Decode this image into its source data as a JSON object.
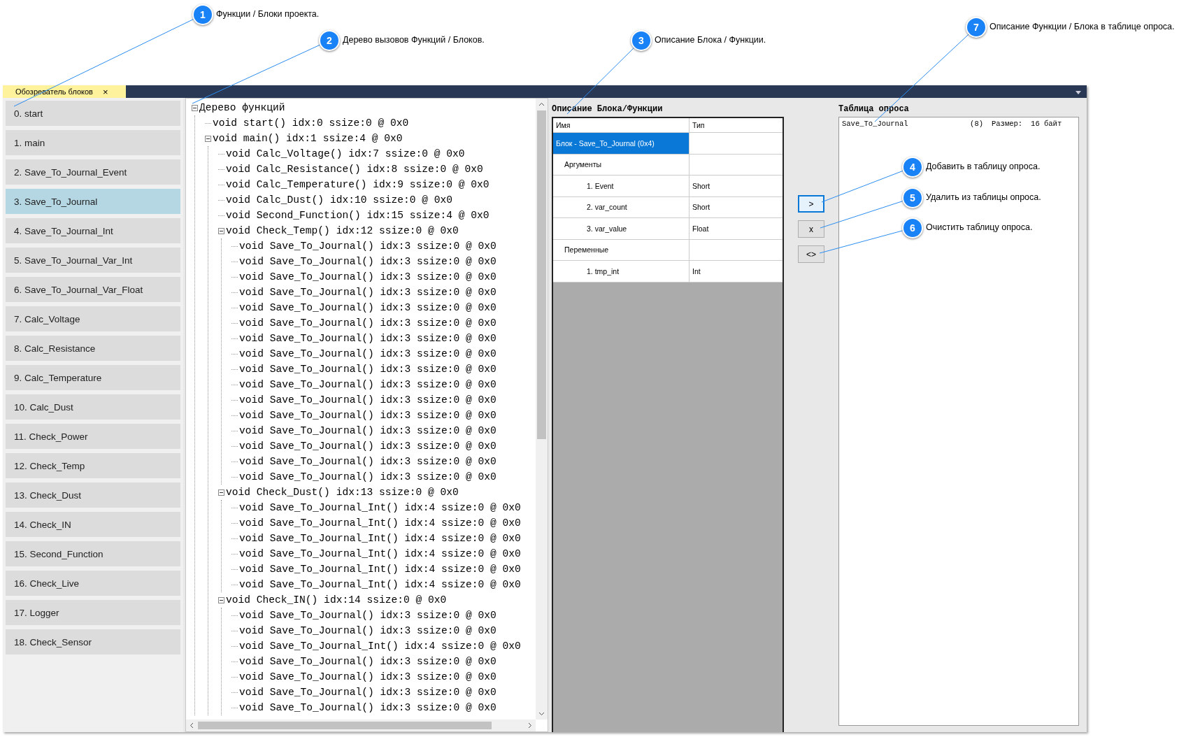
{
  "callouts": [
    {
      "number": "1",
      "text": "Функции / Блоки проекта."
    },
    {
      "number": "2",
      "text": "Дерево вызовов Функций / Блоков."
    },
    {
      "number": "3",
      "text": "Описание Блока / Функции."
    },
    {
      "number": "7",
      "text": "Описание Функции / Блока в таблице опроса."
    },
    {
      "number": "4",
      "text": "Добавить в таблицу опроса."
    },
    {
      "number": "5",
      "text": "Удалить из таблицы опроса."
    },
    {
      "number": "6",
      "text": "Очистить таблицу опроса."
    }
  ],
  "tab": {
    "label": "Обозреватель блоков",
    "close": "×",
    "selected": true
  },
  "blocks": [
    {
      "label": "0. start",
      "selected": false
    },
    {
      "label": "1. main",
      "selected": false
    },
    {
      "label": "2. Save_To_Journal_Event",
      "selected": false
    },
    {
      "label": "3. Save_To_Journal",
      "selected": true
    },
    {
      "label": "4. Save_To_Journal_Int",
      "selected": false
    },
    {
      "label": "5. Save_To_Journal_Var_Int",
      "selected": false
    },
    {
      "label": "6. Save_To_Journal_Var_Float",
      "selected": false
    },
    {
      "label": "7. Calc_Voltage",
      "selected": false
    },
    {
      "label": "8. Calc_Resistance",
      "selected": false
    },
    {
      "label": "9. Calc_Temperature",
      "selected": false
    },
    {
      "label": "10. Calc_Dust",
      "selected": false
    },
    {
      "label": "11. Check_Power",
      "selected": false
    },
    {
      "label": "12. Check_Temp",
      "selected": false
    },
    {
      "label": "13. Check_Dust",
      "selected": false
    },
    {
      "label": "14. Check_IN",
      "selected": false
    },
    {
      "label": "15. Second_Function",
      "selected": false
    },
    {
      "label": "16. Check_Live",
      "selected": false
    },
    {
      "label": "17. Logger",
      "selected": false
    },
    {
      "label": "18. Check_Sensor",
      "selected": false
    }
  ],
  "tree": {
    "label": "Дерево функций",
    "expanded": true,
    "children": [
      {
        "label": "void start() idx:0 ssize:0 @ 0x0"
      },
      {
        "label": "void main() idx:1 ssize:4 @ 0x0",
        "expanded": true,
        "children": [
          {
            "label": "void Calc_Voltage() idx:7 ssize:0 @ 0x0"
          },
          {
            "label": "void Calc_Resistance() idx:8 ssize:0 @ 0x0"
          },
          {
            "label": "void Calc_Temperature() idx:9 ssize:0 @ 0x0"
          },
          {
            "label": "void Calc_Dust() idx:10 ssize:0 @ 0x0"
          },
          {
            "label": "void Second_Function() idx:15 ssize:4 @ 0x0"
          },
          {
            "label": "void Check_Temp() idx:12 ssize:0 @ 0x0",
            "expanded": true,
            "children": [
              {
                "label": "void Save_To_Journal() idx:3 ssize:0 @ 0x0"
              },
              {
                "label": "void Save_To_Journal() idx:3 ssize:0 @ 0x0"
              },
              {
                "label": "void Save_To_Journal() idx:3 ssize:0 @ 0x0"
              },
              {
                "label": "void Save_To_Journal() idx:3 ssize:0 @ 0x0"
              },
              {
                "label": "void Save_To_Journal() idx:3 ssize:0 @ 0x0"
              },
              {
                "label": "void Save_To_Journal() idx:3 ssize:0 @ 0x0"
              },
              {
                "label": "void Save_To_Journal() idx:3 ssize:0 @ 0x0"
              },
              {
                "label": "void Save_To_Journal() idx:3 ssize:0 @ 0x0"
              },
              {
                "label": "void Save_To_Journal() idx:3 ssize:0 @ 0x0"
              },
              {
                "label": "void Save_To_Journal() idx:3 ssize:0 @ 0x0"
              },
              {
                "label": "void Save_To_Journal() idx:3 ssize:0 @ 0x0"
              },
              {
                "label": "void Save_To_Journal() idx:3 ssize:0 @ 0x0"
              },
              {
                "label": "void Save_To_Journal() idx:3 ssize:0 @ 0x0"
              },
              {
                "label": "void Save_To_Journal() idx:3 ssize:0 @ 0x0"
              },
              {
                "label": "void Save_To_Journal() idx:3 ssize:0 @ 0x0"
              },
              {
                "label": "void Save_To_Journal() idx:3 ssize:0 @ 0x0"
              }
            ]
          },
          {
            "label": "void Check_Dust() idx:13 ssize:0 @ 0x0",
            "expanded": true,
            "children": [
              {
                "label": "void Save_To_Journal_Int() idx:4 ssize:0 @ 0x0"
              },
              {
                "label": "void Save_To_Journal_Int() idx:4 ssize:0 @ 0x0"
              },
              {
                "label": "void Save_To_Journal_Int() idx:4 ssize:0 @ 0x0"
              },
              {
                "label": "void Save_To_Journal_Int() idx:4 ssize:0 @ 0x0"
              },
              {
                "label": "void Save_To_Journal_Int() idx:4 ssize:0 @ 0x0"
              },
              {
                "label": "void Save_To_Journal_Int() idx:4 ssize:0 @ 0x0"
              }
            ]
          },
          {
            "label": "void Check_IN() idx:14 ssize:0 @ 0x0",
            "expanded": true,
            "children": [
              {
                "label": "void Save_To_Journal() idx:3 ssize:0 @ 0x0"
              },
              {
                "label": "void Save_To_Journal() idx:3 ssize:0 @ 0x0"
              },
              {
                "label": "void Save_To_Journal_Int() idx:4 ssize:0 @ 0x0"
              },
              {
                "label": "void Save_To_Journal() idx:3 ssize:0 @ 0x0"
              },
              {
                "label": "void Save_To_Journal() idx:3 ssize:0 @ 0x0"
              },
              {
                "label": "void Save_To_Journal() idx:3 ssize:0 @ 0x0"
              },
              {
                "label": "void Save_To_Journal() idx:3 ssize:0 @ 0x0"
              }
            ]
          }
        ]
      }
    ]
  },
  "description": {
    "title": "Описание Блока/Функции",
    "columns": [
      "Имя",
      "Тип"
    ],
    "rows": [
      {
        "name": "Блок - Save_To_Journal (0x4)",
        "selected": true,
        "children": [
          {
            "name": "Аргументы",
            "selected": false,
            "children": [
              {
                "name": "1. Event",
                "type": "Short",
                "selected": false
              },
              {
                "name": "2. var_count",
                "type": "Short",
                "selected": false
              },
              {
                "name": "3. var_value",
                "type": "Float",
                "selected": false
              }
            ]
          },
          {
            "name": "Переменные",
            "selected": false,
            "children": [
              {
                "name": "1. tmp_int",
                "type": "Int",
                "selected": false
              }
            ]
          }
        ]
      }
    ]
  },
  "buttons": [
    {
      "label": ">",
      "focused": true
    },
    {
      "label": "x",
      "focused": false
    },
    {
      "label": "<>",
      "focused": false
    }
  ],
  "poll_table": {
    "title": "Таблица опроса",
    "rows": [
      {
        "name": "Save_To_Journal",
        "count": "(8)",
        "size_label": "Размер:",
        "size": "16 байт"
      }
    ]
  }
}
